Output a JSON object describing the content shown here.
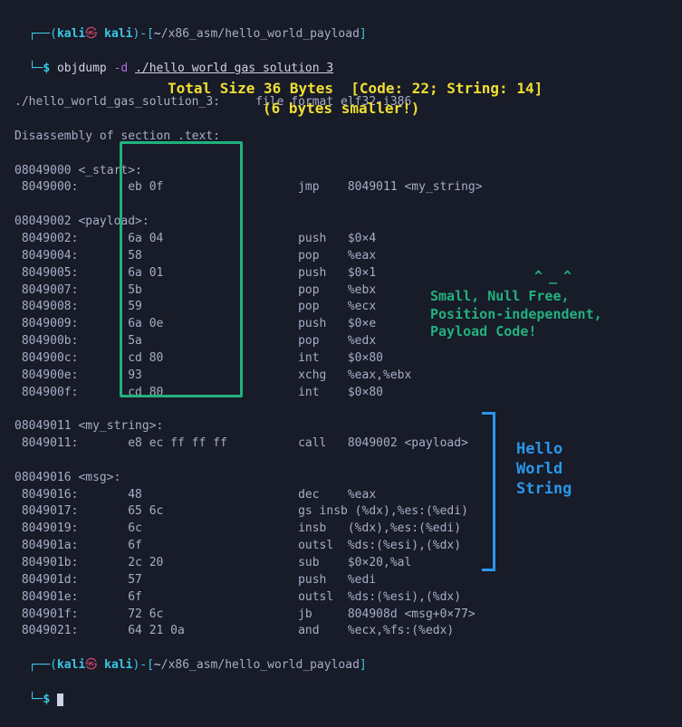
{
  "prompt1": {
    "user": "kali",
    "host": "kali",
    "pathPrefix": "~",
    "path": "/x86_asm/hello_world_payload",
    "cmd": "objdump",
    "flag": "-d",
    "arg": "./hello world gas solution 3"
  },
  "fileinfo": "./hello_world_gas_solution_3:     file format elf32-i386",
  "annotYellow1": "Total Size 36 Bytes  [Code: 22; String: 14]",
  "annotYellow2": "(6 bytes smaller!)",
  "disasmHeader": "Disassembly of section .text:",
  "sections": [
    {
      "header": "08049000 <_start>:",
      "lines": [
        " 8049000:       eb 0f                   jmp    8049011 <my_string>"
      ]
    },
    {
      "header": "08049002 <payload>:",
      "lines": [
        " 8049002:       6a 04                   push   $0×4",
        " 8049004:       58                      pop    %eax",
        " 8049005:       6a 01                   push   $0×1",
        " 8049007:       5b                      pop    %ebx",
        " 8049008:       59                      pop    %ecx",
        " 8049009:       6a 0e                   push   $0×e",
        " 804900b:       5a                      pop    %edx",
        " 804900c:       cd 80                   int    $0×80",
        " 804900e:       93                      xchg   %eax,%ebx",
        " 804900f:       cd 80                   int    $0×80"
      ]
    },
    {
      "header": "08049011 <my_string>:",
      "lines": [
        " 8049011:       e8 ec ff ff ff          call   8049002 <payload>"
      ]
    },
    {
      "header": "08049016 <msg>:",
      "lines": [
        " 8049016:       48                      dec    %eax",
        " 8049017:       65 6c                   gs insb (%dx),%es:(%edi)",
        " 8049019:       6c                      insb   (%dx),%es:(%edi)",
        " 804901a:       6f                      outsl  %ds:(%esi),(%dx)",
        " 804901b:       2c 20                   sub    $0×20,%al",
        " 804901d:       57                      push   %edi",
        " 804901e:       6f                      outsl  %ds:(%esi),(%dx)",
        " 804901f:       72 6c                   jb     804908d <msg+0×77>",
        " 8049021:       64 21 0a                and    %ecx,%fs:(%edx)"
      ]
    }
  ],
  "greenCaret": "^_^",
  "greenAnnot": "Small, Null Free,\nPosition-independent,\nPayload Code!",
  "blueAnnot": "Hello\nWorld\nString",
  "prompt2": {
    "user": "kali",
    "host": "kali",
    "pathPrefix": "~",
    "path": "/x86_asm/hello_world_payload"
  }
}
